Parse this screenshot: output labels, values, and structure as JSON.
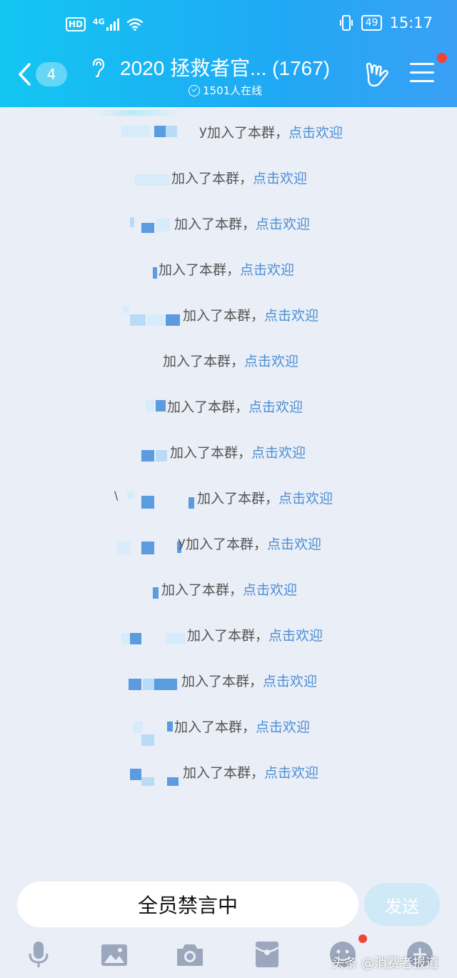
{
  "status_bar": {
    "hd_label": "HD",
    "network_label": "4G",
    "battery_level": "49",
    "time": "15:17"
  },
  "header": {
    "back_badge_count": "4",
    "title": "2020 拯救者官... (1767)",
    "online_text": "1501人在线"
  },
  "messages": [
    {
      "name_suffix": "y",
      "joined_text": "加入了本群，",
      "welcome_link": "点击欢迎"
    },
    {
      "name_suffix": "",
      "joined_text": "加入了本群，",
      "welcome_link": "点击欢迎"
    },
    {
      "name_suffix": "",
      "joined_text": "加入了本群，",
      "welcome_link": "点击欢迎"
    },
    {
      "name_suffix": "",
      "joined_text": "加入了本群，",
      "welcome_link": "点击欢迎"
    },
    {
      "name_suffix": "",
      "joined_text": "加入了本群，",
      "welcome_link": "点击欢迎"
    },
    {
      "name_suffix": "",
      "joined_text": "加入了本群，",
      "welcome_link": "点击欢迎"
    },
    {
      "name_suffix": "",
      "joined_text": "加入了本群，",
      "welcome_link": "点击欢迎"
    },
    {
      "name_suffix": "",
      "joined_text": "加入了本群，",
      "welcome_link": "点击欢迎"
    },
    {
      "name_suffix": "",
      "joined_text": "加入了本群，",
      "welcome_link": "点击欢迎"
    },
    {
      "name_suffix": "y",
      "joined_text": "加入了本群，",
      "welcome_link": "点击欢迎"
    },
    {
      "name_suffix": "",
      "joined_text": "加入了本群，",
      "welcome_link": "点击欢迎"
    },
    {
      "name_suffix": "",
      "joined_text": "加入了本群，",
      "welcome_link": "点击欢迎"
    },
    {
      "name_suffix": "",
      "joined_text": "加入了本群，",
      "welcome_link": "点击欢迎"
    },
    {
      "name_suffix": "",
      "joined_text": "加入了本群，",
      "welcome_link": "点击欢迎"
    },
    {
      "name_suffix": "",
      "joined_text": "加入了本群，",
      "welcome_link": "点击欢迎"
    }
  ],
  "input": {
    "mute_text": "全员禁言中",
    "send_label": "发送"
  },
  "toolbar": {
    "items": [
      "mic-icon",
      "image-icon",
      "camera-icon",
      "red-packet-icon",
      "emoji-icon",
      "plus-icon"
    ]
  },
  "watermark": "头条 @消费者报道",
  "colors": {
    "header_start": "#13c6f2",
    "header_end": "#3aa0f6",
    "link": "#4c8fd6",
    "background": "#eaeef6",
    "notification_dot": "#f2423a"
  }
}
